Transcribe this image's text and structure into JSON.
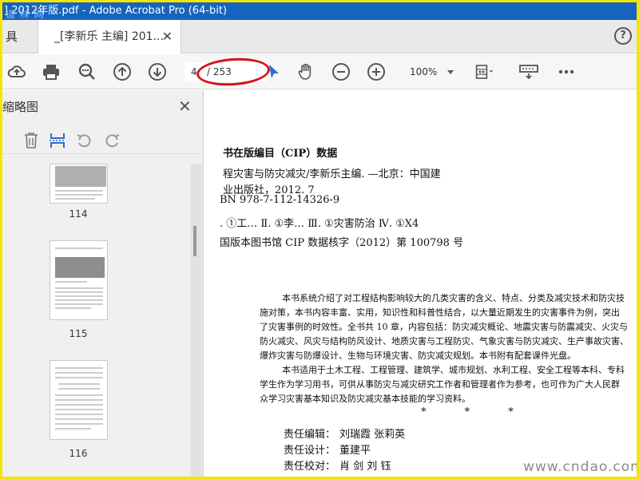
{
  "window": {
    "title": "] 2012年版.pdf - Adobe Acrobat Pro (64-bit)",
    "watermark_top": "道 林 网"
  },
  "tabs": {
    "tools_label": "具",
    "doc_tab_label": "_[李新乐 主编] 201...",
    "close_glyph": "✕",
    "help_glyph": "?"
  },
  "toolbar": {
    "current_page": "4",
    "page_total": "/ 253",
    "zoom": "100%",
    "icons": [
      "upload-icon",
      "print-icon",
      "search-icon",
      "page-up-icon",
      "page-down-icon",
      "select-cursor-icon",
      "hand-icon",
      "zoom-out-icon",
      "zoom-in-icon",
      "zoom-dropdown",
      "fit-page-icon",
      "keyboard-icon",
      "more-icon"
    ],
    "accent_color": "#d3141c"
  },
  "sidebar": {
    "title": "缩略图",
    "close_glyph": "✕",
    "thumbnails": [
      {
        "page": "114"
      },
      {
        "page": "115"
      },
      {
        "page": "116"
      }
    ]
  },
  "document": {
    "heading": "书在版编目（CIP）数据",
    "cip_lines": [
      "程灾害与防灾减灾/李新乐主编. —北京：中国建",
      "业出版社，2012. 7",
      "BN 978-7-112-14326-9",
      ". ①工…   Ⅱ. ①李…   Ⅲ. ①灾害防治   Ⅳ. ①X4",
      "国版本图书馆 CIP 数据核字（2012）第 100798 号"
    ],
    "body_paragraphs": [
      "本书系统介绍了对工程结构影响较大的几类灾害的含义、特点、分类及减灾技术和防灾技",
      "施对策，本书内容丰富、实用，知识性和科普性结合，以大量近期发生的灾害事件为例，突出",
      "了灾害事例的时效性。全书共 10 章，内容包括：防灾减灾概论、地震灾害与防震减灾、火灾与",
      "防火减灾、风灾与结构防风设计、地质灾害与工程防灾、气象灾害与防灾减灾、生产事故灾害、",
      "爆炸灾害与防爆设计、生物与环境灾害、防灾减灾规划。本书附有配套课件光盘。",
      "本书适用于土木工程、工程管理、建筑学、城市规划、水利工程、安全工程等本科、专科",
      "学生作为学习用书，可供从事防灾与减灾研究工作者和管理者作为参考，也可作为广大人民群",
      "众学习灾害基本知识及防灾减灾基本技能的学习资料。"
    ],
    "stars": "* * *",
    "credits": [
      {
        "label": "责任编辑：",
        "value": "刘瑞霞   张莉英"
      },
      {
        "label": "责任设计：",
        "value": "董建平"
      },
      {
        "label": "责任校对：",
        "value": "肖   剑   刘   钰"
      }
    ]
  },
  "watermark_bottom": "www.cndao.com"
}
